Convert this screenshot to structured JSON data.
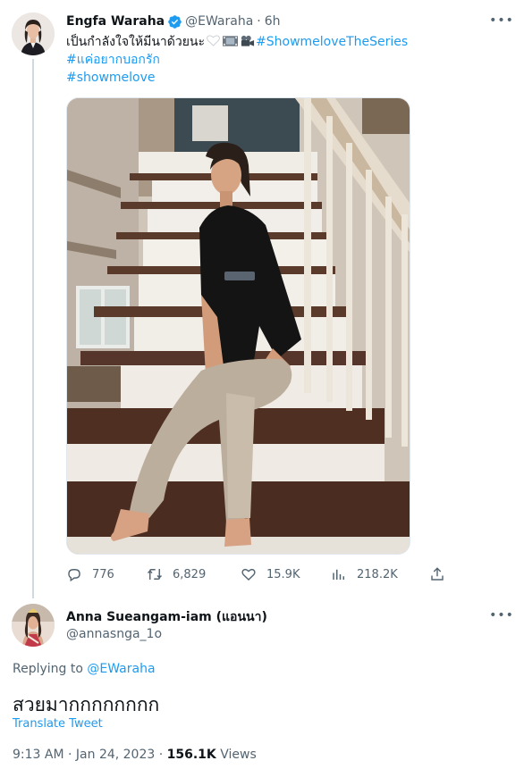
{
  "tweet": {
    "author_name": "Engfa Waraha",
    "handle": "@EWaraha",
    "separator": "·",
    "time": "6h",
    "text_line1_prefix": "เป็นกำลังใจให้มีนาด้วยนะ",
    "hashtag1": "#ShowmeloveTheSeries",
    "hashtag2": "#แค่อยากบอกรัก",
    "hashtag3": "#showmelove",
    "emojis": [
      "white-heart",
      "film-frames",
      "movie-camera"
    ],
    "stats": {
      "replies": "776",
      "retweets": "6,829",
      "likes": "15.9K",
      "views": "218.2K"
    }
  },
  "reply": {
    "author_name": "Anna Sueangam-iam (แอนนา)",
    "handle": "@annasnga_1o",
    "replying_label": "Replying to",
    "replying_to": "@EWaraha",
    "text": "สวยมากกกกกกกก",
    "translate_label": "Translate Tweet",
    "time": "9:13 AM",
    "date": "Jan 24, 2023",
    "views_count": "156.1K",
    "views_label": "Views"
  },
  "colors": {
    "accent": "#1d9bf0",
    "text": "#0f1419",
    "secondary": "#536471",
    "divider": "#cfd9de"
  }
}
